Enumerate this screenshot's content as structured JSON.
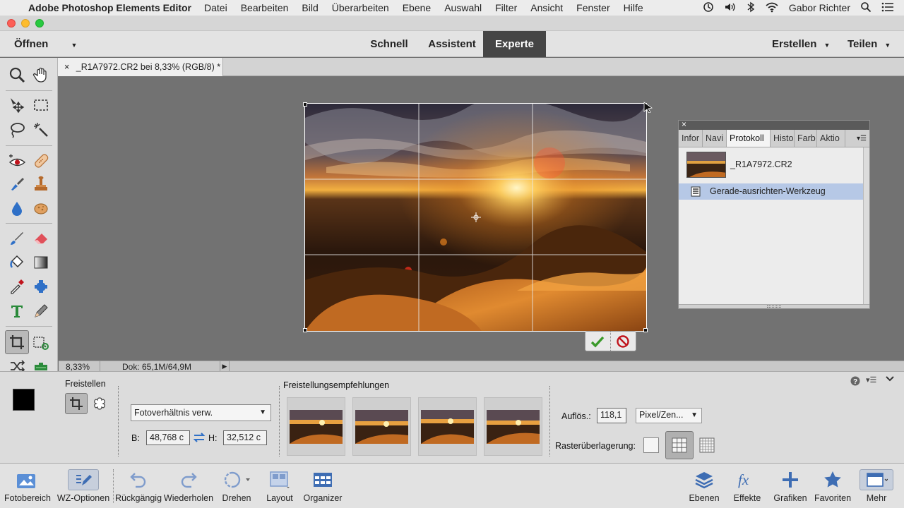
{
  "menubar": {
    "app_name": "Adobe Photoshop Elements Editor",
    "menus": [
      "Datei",
      "Bearbeiten",
      "Bild",
      "Überarbeiten",
      "Ebene",
      "Auswahl",
      "Filter",
      "Ansicht",
      "Fenster",
      "Hilfe"
    ],
    "user": "Gabor Richter"
  },
  "modebar": {
    "open_label": "Öffnen",
    "modes": [
      "Schnell",
      "Assistent",
      "Experte"
    ],
    "active_mode": "Experte",
    "create_label": "Erstellen",
    "share_label": "Teilen"
  },
  "document": {
    "tab_title": "_R1A7972.CR2 bei 8,33% (RGB/8) *",
    "close_glyph": "×"
  },
  "statusbar": {
    "zoom": "8,33%",
    "doc_info": "Dok: 65,1M/64,9M"
  },
  "panel": {
    "close_glyph": "×",
    "tabs": [
      "Infor",
      "Navi",
      "Protokoll",
      "Histo",
      "Farb",
      "Aktio"
    ],
    "active_tab": "Protokoll",
    "history": [
      {
        "label": "_R1A7972.CR2",
        "type": "snapshot"
      },
      {
        "label": "Gerade-ausrichten-Werkzeug",
        "type": "step",
        "selected": true
      }
    ]
  },
  "options": {
    "section_title": "Freistellen",
    "aspect_select": "Fotoverhältnis verw.",
    "width_label": "B:",
    "width_value": "48,768 c",
    "height_label": "H:",
    "height_value": "32,512 c",
    "suggestions_title": "Freistellungsempfehlungen",
    "resolution_label": "Auflös.:",
    "resolution_value": "118,1",
    "resolution_unit": "Pixel/Zen...",
    "grid_label": "Rasterüberlagerung:"
  },
  "taskbar": {
    "left": [
      {
        "label": "Fotobereich"
      },
      {
        "label": "WZ-Optionen"
      },
      {
        "label": "Rückgängig"
      },
      {
        "label": "Wiederholen"
      },
      {
        "label": "Drehen"
      },
      {
        "label": "Layout"
      },
      {
        "label": "Organizer"
      }
    ],
    "right": [
      {
        "label": "Ebenen"
      },
      {
        "label": "Effekte"
      },
      {
        "label": "Grafiken"
      },
      {
        "label": "Favoriten"
      },
      {
        "label": "Mehr"
      }
    ]
  },
  "colors": {
    "foreground": "#000000",
    "background": "#ffffff",
    "accent_selected": "#b6c8e6",
    "active_mode_bg": "#454545",
    "commit_green": "#3a9a2a",
    "cancel_red": "#c0141c"
  }
}
